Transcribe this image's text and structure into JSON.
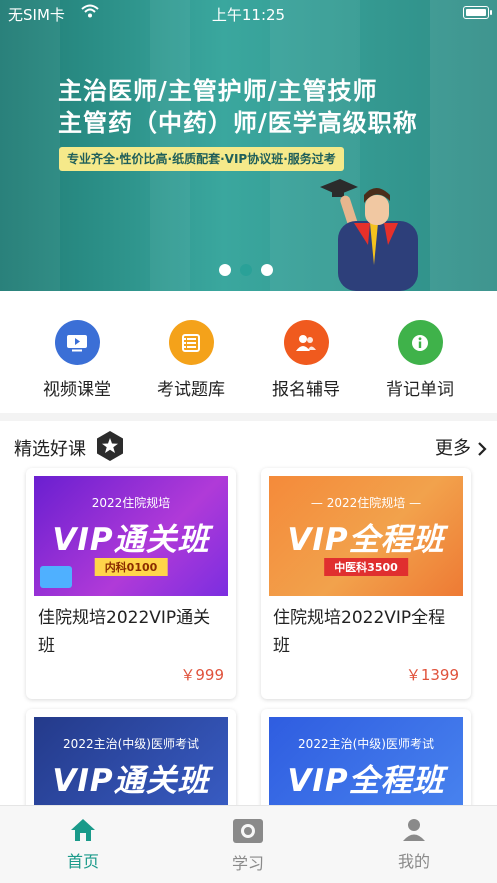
{
  "status_bar": {
    "carrier": "无SIM卡",
    "time": "上午11:25",
    "wifi_icon": "wifi-icon",
    "battery_icon": "battery-icon"
  },
  "banner": {
    "title_line1": "主治医师/主管护师/主管技师",
    "title_line2": "主管药（中药）师/医学高级职称",
    "tagline": "专业齐全·性价比高·纸质配套·VIP协议班·服务过考",
    "carousel": {
      "count": 3,
      "active_index": 1
    },
    "colors": {
      "background": "#2f8d86",
      "tagline_bg": "#f5e98a"
    }
  },
  "menu": [
    {
      "label": "视频课堂",
      "icon": "video-icon",
      "color": "#3b6fd6"
    },
    {
      "label": "考试题库",
      "icon": "question-bank-icon",
      "color": "#f4a21a"
    },
    {
      "label": "报名辅导",
      "icon": "users-icon",
      "color": "#f05a1e"
    },
    {
      "label": "背记单词",
      "icon": "info-icon",
      "color": "#3fb24a"
    }
  ],
  "courses": {
    "section_title": "精选好课",
    "more_label": "更多",
    "items": [
      {
        "banner_top": "2022住院规培",
        "banner_main": "VIP通关班",
        "banner_tag": "内科0100",
        "title": "佳院规培2022VIP通关班",
        "price": "￥999",
        "theme": "purple"
      },
      {
        "banner_top": "— 2022住院规培 —",
        "banner_main": "VIP全程班",
        "banner_tag": "中医科3500",
        "title": "住院规培2022VIP全程班",
        "price": "￥1399",
        "theme": "orange"
      },
      {
        "banner_top": "2022主治(中级)医师考试",
        "banner_main": "VIP通关班",
        "banner_tag": "",
        "title": "",
        "price": "",
        "theme": "navy"
      },
      {
        "banner_top": "2022主治(中级)医师考试",
        "banner_main": "VIP全程班",
        "banner_tag": "",
        "title": "",
        "price": "",
        "theme": "blue"
      }
    ]
  },
  "tabbar": [
    {
      "label": "首页",
      "icon": "home-icon",
      "active": true
    },
    {
      "label": "学习",
      "icon": "study-icon",
      "active": false
    },
    {
      "label": "我的",
      "icon": "profile-icon",
      "active": false
    }
  ],
  "accent_color": "#1a9a8a",
  "price_color": "#e0533c"
}
